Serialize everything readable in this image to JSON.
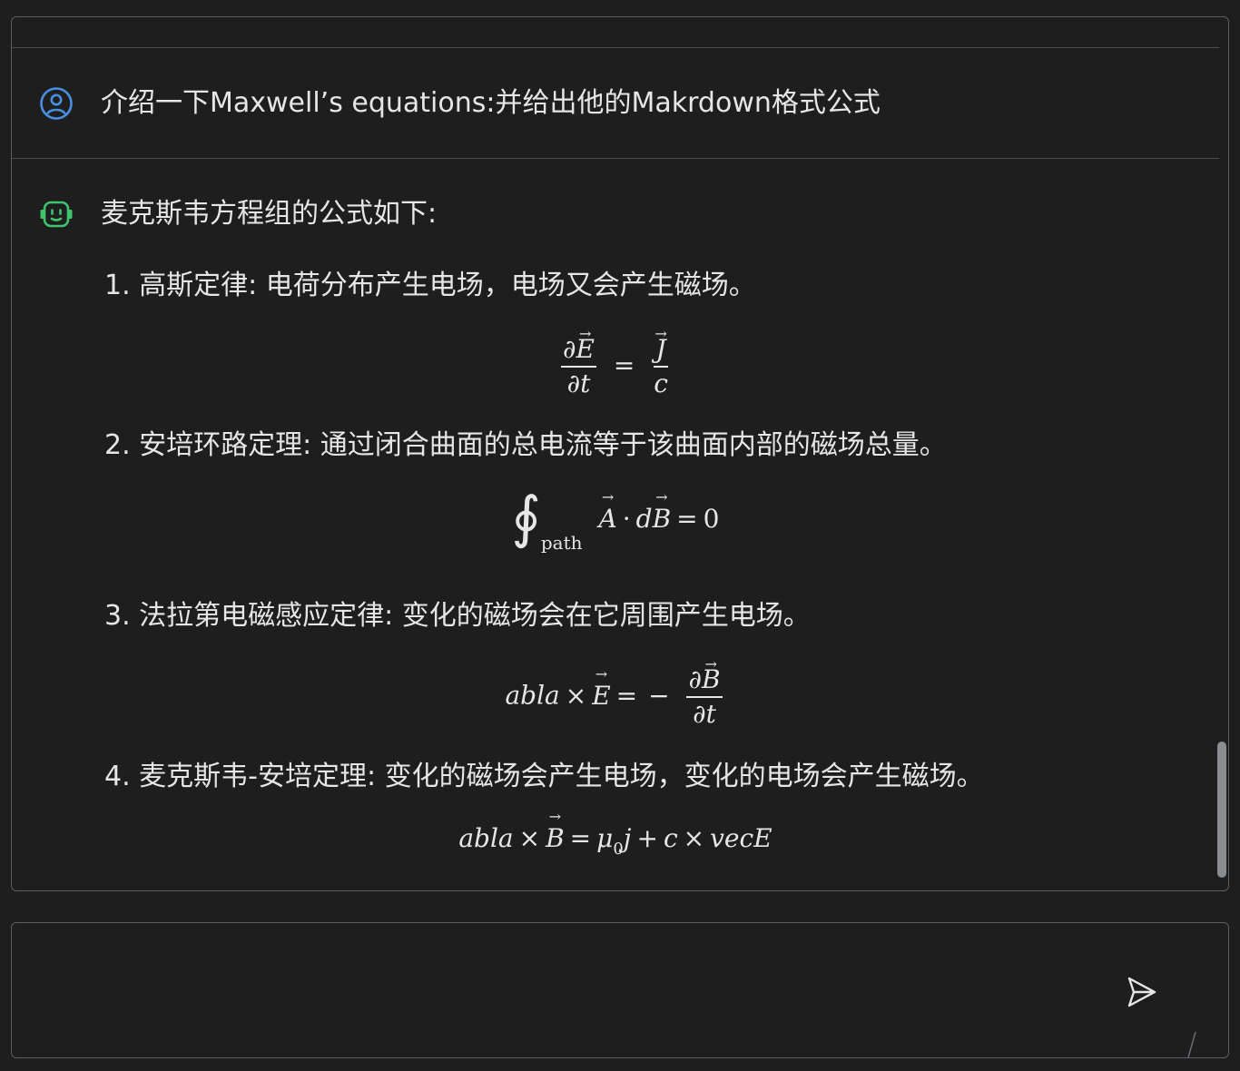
{
  "user_message": {
    "text": "介绍一下Maxwell’s equations:并给出他的Makrdown格式公式"
  },
  "bot_message": {
    "intro": "麦克斯韦方程组的公式如下:",
    "items": [
      {
        "label": "1. 高斯定律: 电荷分布产生电场，电场又会产生磁场。"
      },
      {
        "label": "2. 安培环路定理: 通过闭合曲面的总电流等于该曲面内部的磁场总量。"
      },
      {
        "label": "3. 法拉第电磁感应定律: 变化的磁场会在它周围产生电场。"
      },
      {
        "label": "4. 麦克斯韦-安培定理: 变化的磁场会产生电场，变化的电场会产生磁场。"
      }
    ],
    "formulas": {
      "f1": {
        "num_d": "∂",
        "num_v": "E",
        "eq": "=",
        "rhs_num": "J",
        "den1": "∂t",
        "den2": "c"
      },
      "f2": {
        "oint": "∮",
        "sub": "path",
        "a": "A",
        "dot": "·",
        "d": "d",
        "b": "B",
        "eq": "=",
        "zero": "0"
      },
      "f3": {
        "abla": "abla",
        "times": "×",
        "e": "E",
        "eq": "=",
        "minus": "−",
        "num_d": "∂",
        "num_v": "B",
        "den": "∂t"
      },
      "f4": {
        "abla": "abla",
        "times": "×",
        "b": "B",
        "eq": "=",
        "mu": "μ",
        "mu_sub": "0",
        "j": "j",
        "plus": "+",
        "c": "c",
        "times2": "×",
        "vec": "vecE"
      }
    }
  },
  "input": {
    "value": "",
    "placeholder": ""
  },
  "icons": {
    "user_avatar": "user-circle-icon",
    "bot_avatar": "robot-icon",
    "send": "send-icon"
  },
  "colors": {
    "background": "#1e1e1e",
    "text": "#e6e6e6",
    "user_avatar": "#4a90e2",
    "bot_avatar": "#3ec46d",
    "border": "#5a5e66"
  }
}
